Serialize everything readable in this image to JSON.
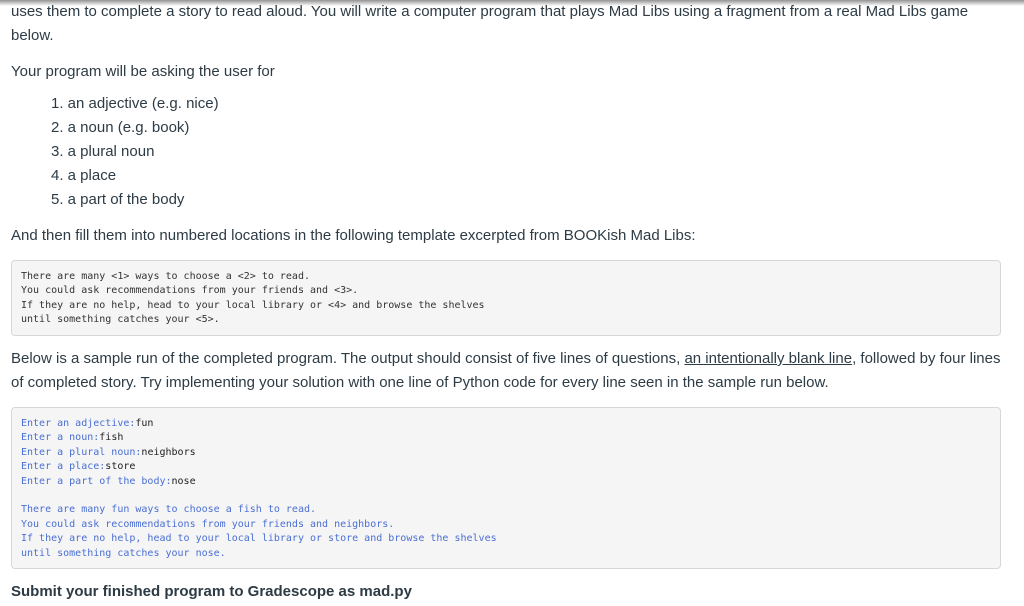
{
  "intro_text": "uses them to complete a story to read aloud. You will write a computer program that plays Mad Libs using a fragment from a real Mad Libs game below.",
  "ask_text": "Your program will be asking the user for",
  "ask_items": [
    "1. an adjective (e.g. nice)",
    "2. a noun (e.g. book)",
    "3. a plural noun",
    "4. a place",
    "5. a part of the body"
  ],
  "fill_text": "And then fill them into numbered locations in the following template excerpted from BOOKish Mad Libs:",
  "template_lines": [
    "There are many <1> ways to choose a <2> to read.",
    "You could ask recommendations from your friends and <3>.",
    "If they are no help, head to your local library or <4> and browse the shelves",
    "until something catches your <5>."
  ],
  "sample": {
    "before": "Below is a sample run of the completed program. The output should consist of five lines of questions, ",
    "link": "an intentionally blank line",
    "after": ", followed by four lines of completed story. Try implementing your solution with one line of Python code for every line seen in the sample run below."
  },
  "sample_run": {
    "prompts": [
      {
        "prompt": "Enter an adjective:",
        "input": "fun"
      },
      {
        "prompt": "Enter a noun:",
        "input": "fish"
      },
      {
        "prompt": "Enter a plural noun:",
        "input": "neighbors"
      },
      {
        "prompt": "Enter a place:",
        "input": "store"
      },
      {
        "prompt": "Enter a part of the body:",
        "input": "nose"
      }
    ],
    "story": [
      "There are many fun ways to choose a fish to read.",
      "You could ask recommendations from your friends and neighbors.",
      "If they are no help, head to your local library or store and browse the shelves",
      "until something catches your nose."
    ]
  },
  "submit_text": "Submit your finished program to Gradescope as mad.py"
}
